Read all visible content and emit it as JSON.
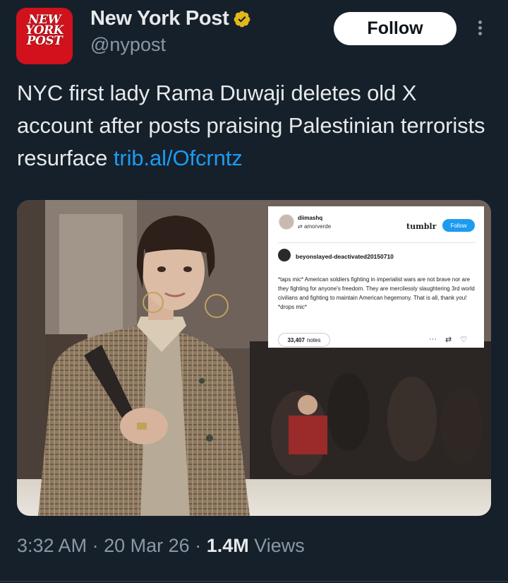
{
  "account": {
    "name": "New York Post",
    "handle": "@nypost",
    "logo_lines": [
      "NEW",
      "YORK",
      "POST"
    ],
    "verified_icon": "verified-gold-badge-icon"
  },
  "follow_label": "Follow",
  "more_icon": "more-vertical-icon",
  "tweet": {
    "text": "NYC first lady Rama Duwaji deletes old X account after posts praising Palestinian terrorists resurface ",
    "link": "trib.al/Ofcrntz"
  },
  "embedded_post": {
    "blog_name": "diimashq",
    "reblog_from": "amorverde",
    "platform": "tumblr",
    "follow_label": "Follow",
    "author": "beyonslayed-deactivated20150710",
    "body": "*taps mic* American soldiers fighting in imperialist wars are not brave nor are they fighting for anyone's freedom. They are mercilessly slaughtering 3rd world civilians and fighting to maintain American hegemony. That is all, thank you! *drops mic*",
    "notes_count": "33,407",
    "notes_label": "notes"
  },
  "meta": {
    "time": "3:32 AM",
    "date": "20 Mar 26",
    "views_count": "1.4M",
    "views_label": "Views"
  },
  "colors": {
    "background": "#15202b",
    "link": "#1d9bf0",
    "secondary_text": "#8b98a5",
    "logo_red": "#d1111b",
    "badge_gold": "#e2b719"
  }
}
